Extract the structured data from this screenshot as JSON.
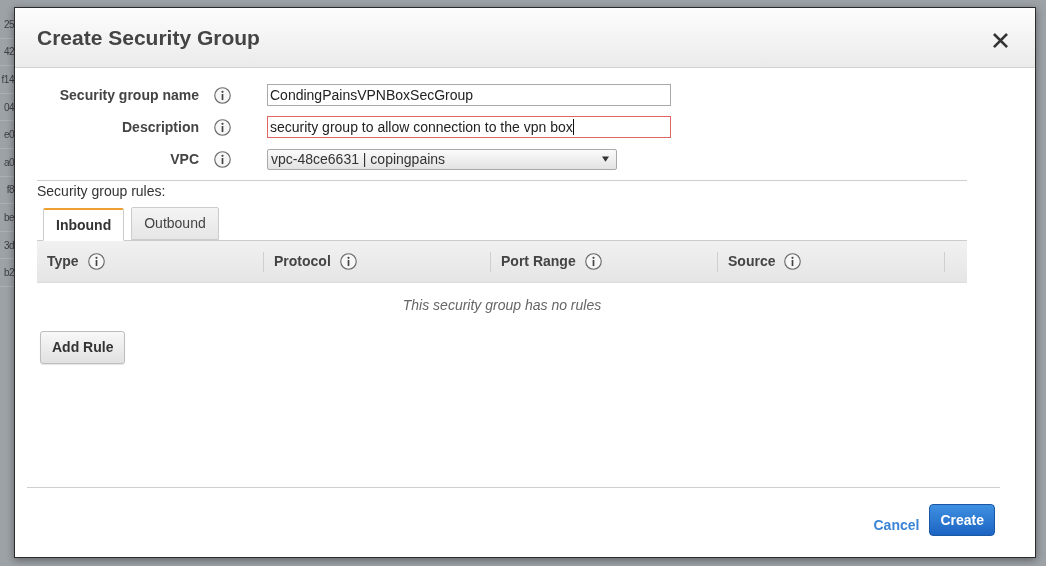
{
  "background_table": {
    "rows": [
      "25",
      "42",
      "f14",
      "04",
      "e0",
      "a0",
      "f8",
      "be",
      "3d",
      "b2"
    ]
  },
  "dialog": {
    "title": "Create Security Group"
  },
  "form": {
    "fields": [
      {
        "kind": "text",
        "label": "Security group name",
        "value": "CondingPainsVPNBoxSecGroup",
        "focused": false
      },
      {
        "kind": "text",
        "label": "Description",
        "value": "security group to allow connection to the vpn box",
        "focused": true
      },
      {
        "kind": "select",
        "label": "VPC",
        "value": "vpc-48ce6631 | copingpains"
      }
    ]
  },
  "rules": {
    "heading": "Security group rules:",
    "tabs": [
      {
        "label": "Inbound",
        "selected": true
      },
      {
        "label": "Outbound",
        "selected": false
      }
    ],
    "columns": [
      "Type",
      "Protocol",
      "Port Range",
      "Source"
    ],
    "empty_message": "This security group has no rules",
    "add_button": "Add Rule"
  },
  "footer": {
    "cancel": "Cancel",
    "create": "Create"
  }
}
